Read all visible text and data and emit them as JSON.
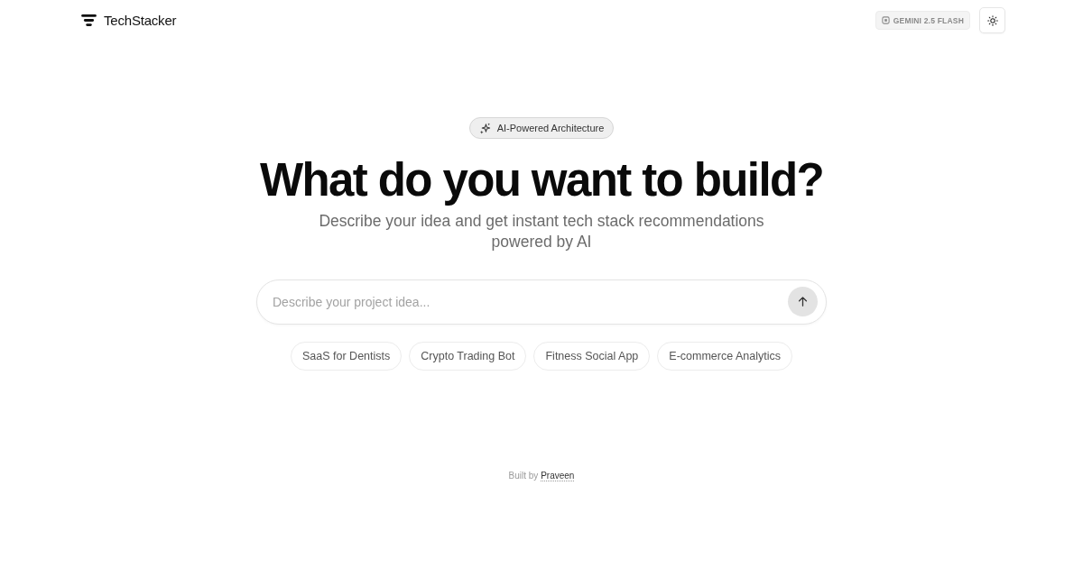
{
  "header": {
    "logo_text": "TechStacker",
    "model_badge": "GEMINI 2.5 FLASH"
  },
  "hero": {
    "badge": "AI-Powered Architecture",
    "title": "What do you want to build?",
    "subtitle": "Describe your idea and get instant tech stack recommendations powered by AI"
  },
  "prompt": {
    "placeholder": "Describe your project idea..."
  },
  "suggestions": [
    "SaaS for Dentists",
    "Crypto Trading Bot",
    "Fitness Social App",
    "E-commerce Analytics"
  ],
  "footer": {
    "prefix": "Built by",
    "link": "Praveen"
  }
}
